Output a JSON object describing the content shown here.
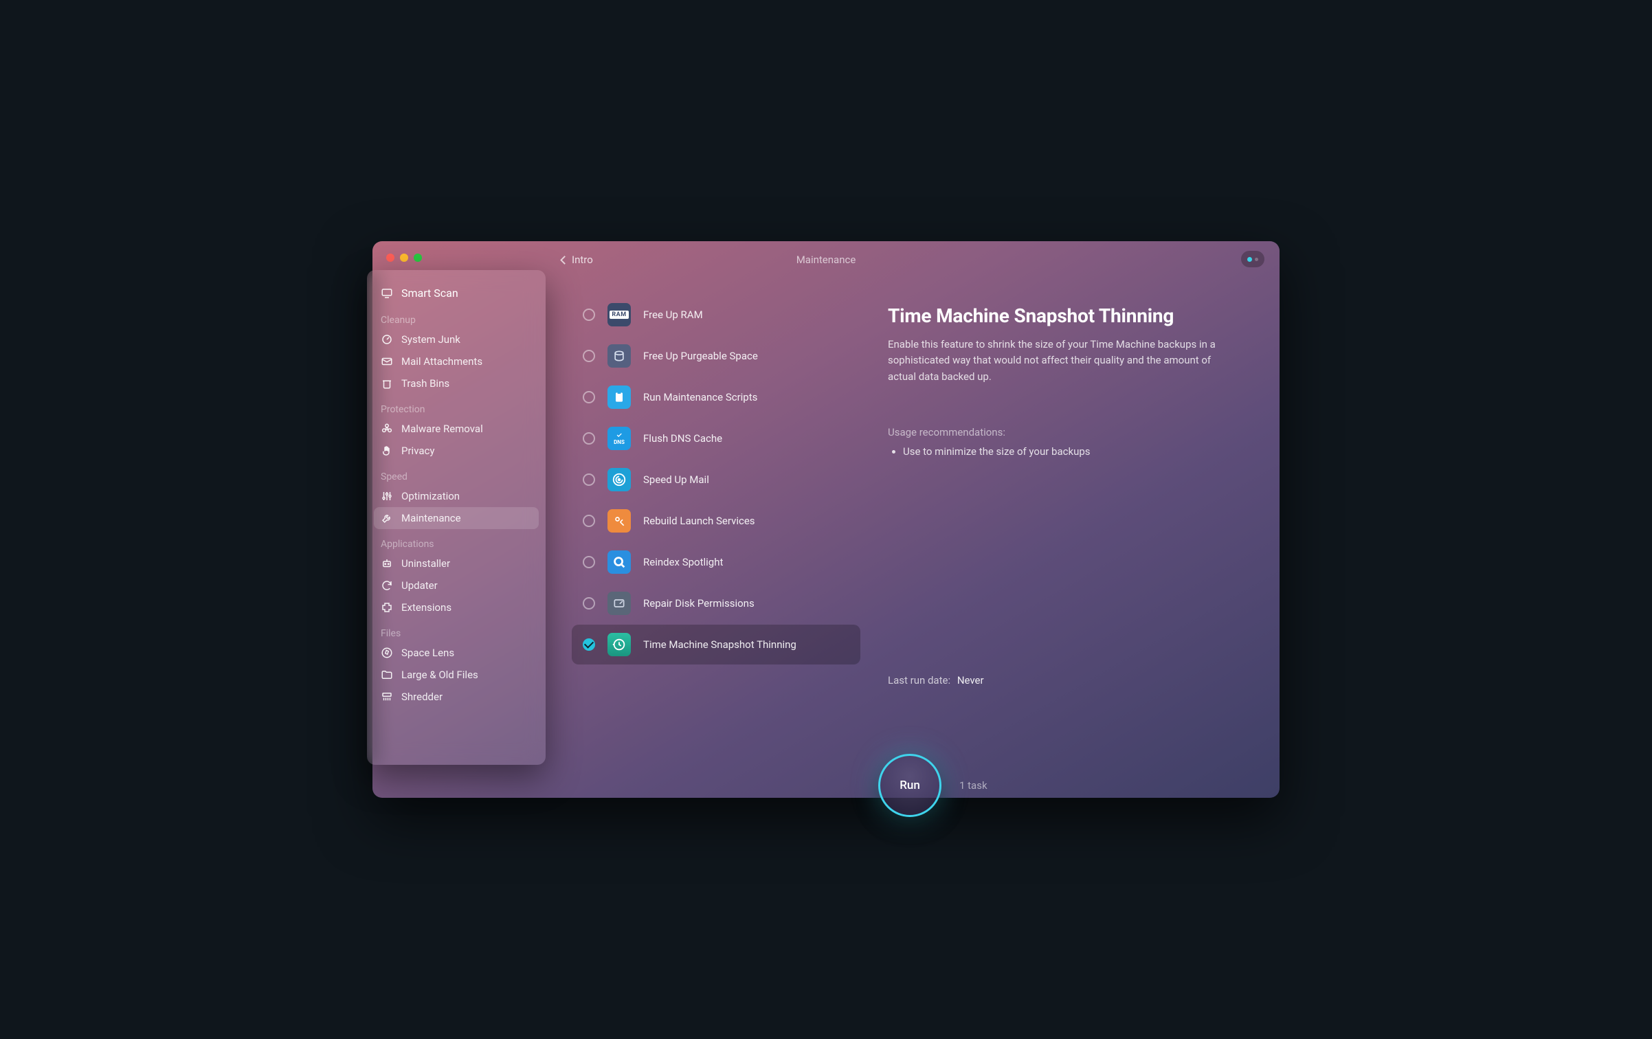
{
  "header": {
    "back_label": "Intro",
    "title": "Maintenance"
  },
  "sidebar": {
    "smart_scan": "Smart Scan",
    "sections": [
      {
        "label": "Cleanup",
        "items": [
          {
            "name": "system-junk",
            "label": "System Junk",
            "icon": "gauge-icon"
          },
          {
            "name": "mail-attachments",
            "label": "Mail Attachments",
            "icon": "envelope-icon"
          },
          {
            "name": "trash-bins",
            "label": "Trash Bins",
            "icon": "trash-icon"
          }
        ]
      },
      {
        "label": "Protection",
        "items": [
          {
            "name": "malware-removal",
            "label": "Malware Removal",
            "icon": "biohazard-icon"
          },
          {
            "name": "privacy",
            "label": "Privacy",
            "icon": "hand-icon"
          }
        ]
      },
      {
        "label": "Speed",
        "items": [
          {
            "name": "optimization",
            "label": "Optimization",
            "icon": "sliders-icon"
          },
          {
            "name": "maintenance",
            "label": "Maintenance",
            "icon": "wrench-icon",
            "active": true
          }
        ]
      },
      {
        "label": "Applications",
        "items": [
          {
            "name": "uninstaller",
            "label": "Uninstaller",
            "icon": "robot-icon"
          },
          {
            "name": "updater",
            "label": "Updater",
            "icon": "refresh-icon"
          },
          {
            "name": "extensions",
            "label": "Extensions",
            "icon": "puzzle-icon"
          }
        ]
      },
      {
        "label": "Files",
        "items": [
          {
            "name": "space-lens",
            "label": "Space Lens",
            "icon": "compass-icon"
          },
          {
            "name": "large-old-files",
            "label": "Large & Old Files",
            "icon": "folder-icon"
          },
          {
            "name": "shredder",
            "label": "Shredder",
            "icon": "shredder-icon"
          }
        ]
      }
    ]
  },
  "tasks": [
    {
      "name": "free-up-ram",
      "label": "Free Up RAM",
      "icon": "ram-icon",
      "checked": false
    },
    {
      "name": "free-up-purgeable-space",
      "label": "Free Up Purgeable Space",
      "icon": "purgeable-icon",
      "checked": false
    },
    {
      "name": "run-maintenance-scripts",
      "label": "Run Maintenance Scripts",
      "icon": "clipboard-icon",
      "checked": false
    },
    {
      "name": "flush-dns-cache",
      "label": "Flush DNS Cache",
      "icon": "dns-icon",
      "checked": false
    },
    {
      "name": "speed-up-mail",
      "label": "Speed Up Mail",
      "icon": "mail-speed-icon",
      "checked": false
    },
    {
      "name": "rebuild-launch-services",
      "label": "Rebuild Launch Services",
      "icon": "launch-icon",
      "checked": false
    },
    {
      "name": "reindex-spotlight",
      "label": "Reindex Spotlight",
      "icon": "spotlight-icon",
      "checked": false
    },
    {
      "name": "repair-disk-permissions",
      "label": "Repair Disk Permissions",
      "icon": "disk-icon",
      "checked": false
    },
    {
      "name": "time-machine-snapshot-thinning",
      "label": "Time Machine Snapshot Thinning",
      "icon": "timemachine-icon",
      "checked": true,
      "selected": true
    }
  ],
  "detail": {
    "title": "Time Machine Snapshot Thinning",
    "description": "Enable this feature to shrink the size of your Time Machine backups in a sophisticated way that would not affect their quality and the amount of actual data backed up.",
    "usage_label": "Usage recommendations:",
    "usage_items": [
      "Use to minimize the size of your backups"
    ],
    "last_run_label": "Last run date:",
    "last_run_value": "Never"
  },
  "action": {
    "run_label": "Run",
    "task_count_label": "1 task"
  }
}
